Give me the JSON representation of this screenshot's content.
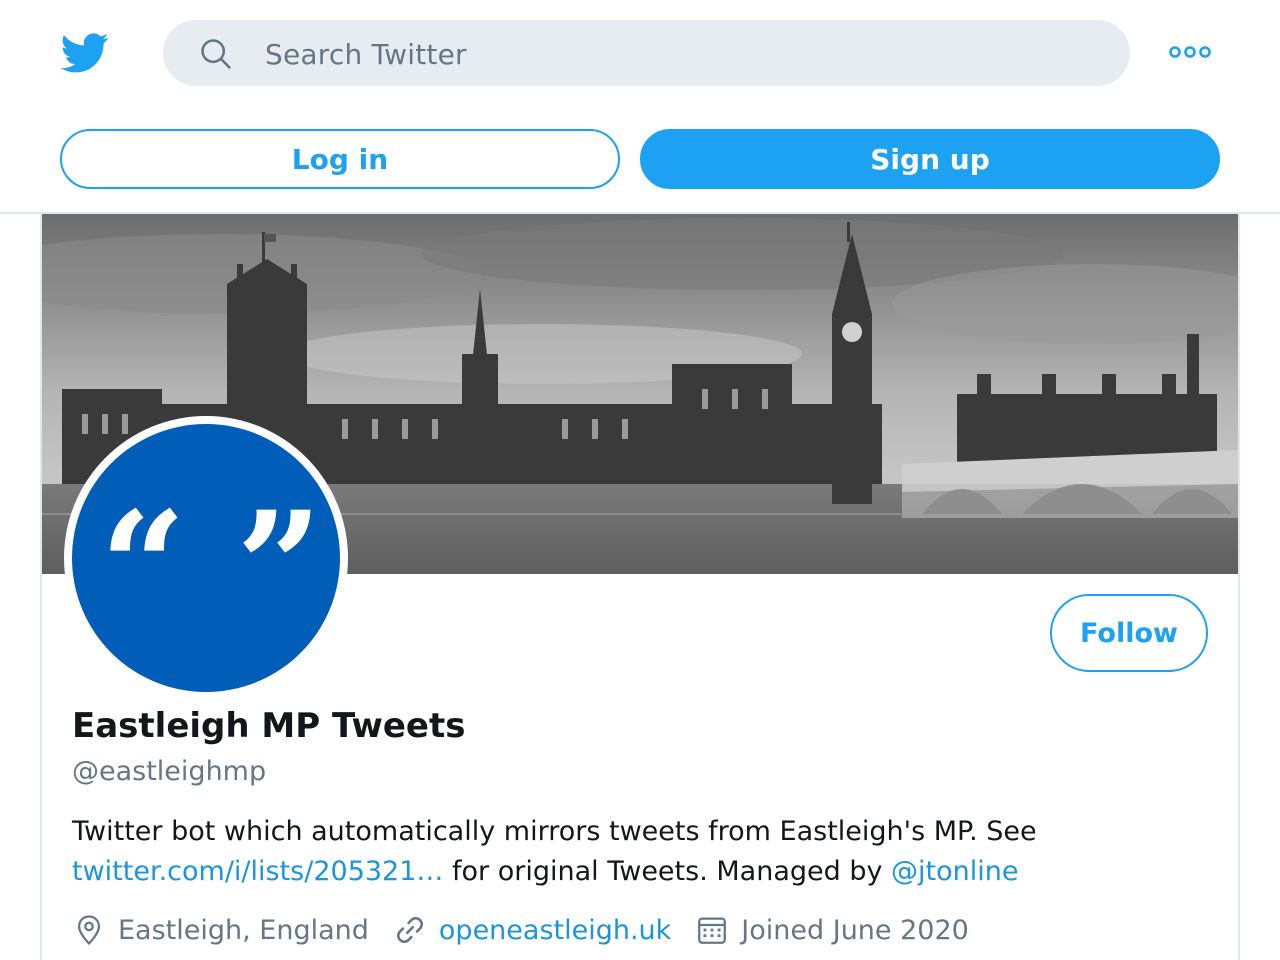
{
  "search": {
    "placeholder": "Search Twitter"
  },
  "auth": {
    "login_label": "Log in",
    "signup_label": "Sign up"
  },
  "profile": {
    "name": "Eastleigh MP Tweets",
    "handle": "@eastleighmp",
    "bio": {
      "part1": "Twitter bot which automatically mirrors tweets from Eastleigh's MP. See ",
      "link1": "twitter.com/i/lists/205321…",
      "part2": " for original Tweets. Managed by ",
      "link2": "@jtonline"
    },
    "location": "Eastleigh, England",
    "website": "openeastleigh.uk",
    "joined": "Joined June 2020",
    "follow_label": "Follow",
    "avatar_quotes": {
      "open": "“",
      "close": "”"
    }
  },
  "icons": {
    "logo": "twitter-bird-icon",
    "search": "search-icon",
    "more": "more-dots-icon",
    "location": "location-pin-icon",
    "link": "link-icon",
    "calendar": "calendar-icon"
  },
  "colors": {
    "accent": "#1da1f2",
    "link": "#1b95e0",
    "avatar_bg": "#005eb8",
    "muted": "#657786",
    "search_bg": "#e6ecf0"
  }
}
